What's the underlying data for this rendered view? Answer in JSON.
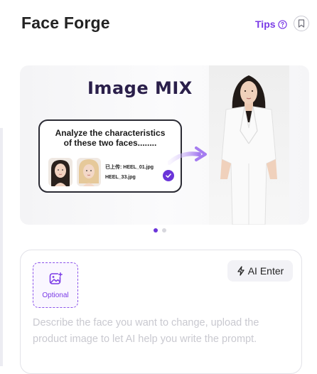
{
  "header": {
    "title": "Face Forge",
    "tips_label": "Tips",
    "tips_icon": "question-circle-icon",
    "bookmark_icon": "bookmark-icon"
  },
  "banner": {
    "title": "Image MIX",
    "card_title_line1": "Analyze the characteristics",
    "card_title_line2": "of these two faces........",
    "file1": "已上传: HEEL_01.jpg",
    "file2": "HEEL_33.jpg",
    "arrow_icon": "arrow-right-icon",
    "check_icon": "check-circle-icon"
  },
  "carousel": {
    "count": 2,
    "active_index": 0
  },
  "prompt": {
    "upload_label": "Optional",
    "upload_icon": "image-add-icon",
    "ai_enter_label": "AI Enter",
    "ai_enter_icon": "lightning-icon",
    "placeholder": "Describe the face you want to change, upload the product image to let AI help you write the prompt."
  },
  "colors": {
    "accent": "#7a3ae6",
    "accent_dark": "#6b35d9",
    "placeholder": "#c9c9d0",
    "title": "#232323"
  }
}
